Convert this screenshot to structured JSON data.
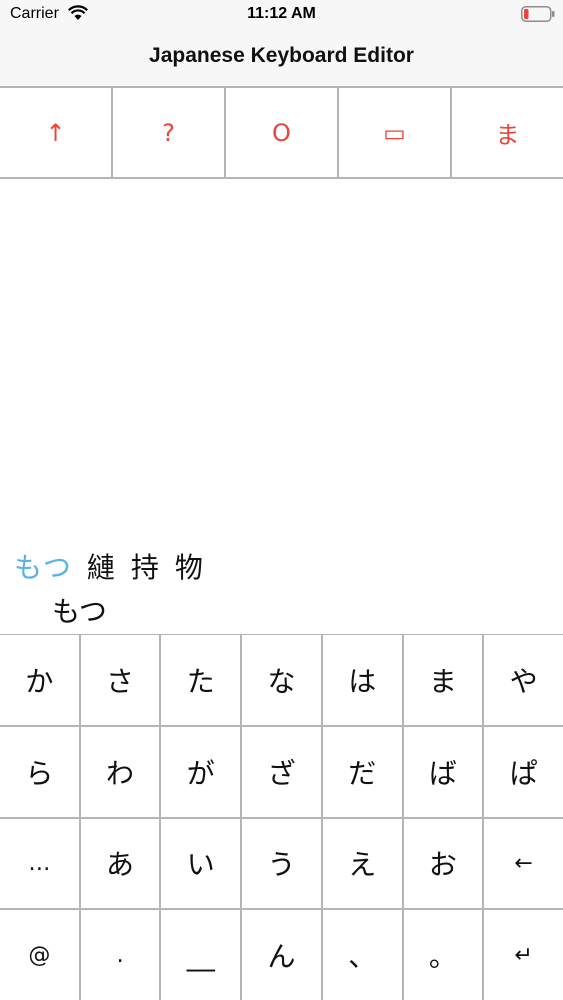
{
  "status_bar": {
    "carrier": "Carrier",
    "time": "11:12 AM"
  },
  "nav": {
    "title": "Japanese Keyboard Editor"
  },
  "toolbar": {
    "buttons": [
      "↑",
      "?",
      "O",
      "▭",
      "ま"
    ]
  },
  "candidates": {
    "items": [
      "もつ",
      "縺",
      "持",
      "物"
    ],
    "composing": "もつ"
  },
  "keyboard": {
    "rows": [
      [
        "か",
        "さ",
        "た",
        "な",
        "は",
        "ま",
        "や"
      ],
      [
        "ら",
        "わ",
        "が",
        "ざ",
        "だ",
        "ば",
        "ぱ"
      ],
      [
        "…",
        "あ",
        "い",
        "う",
        "え",
        "お",
        "←"
      ],
      [
        "@",
        ".",
        "__",
        "ん",
        "、",
        "。",
        "↵"
      ]
    ]
  },
  "colors": {
    "accent_red": "#e8453c",
    "selected_candidate": "#5ab2e4",
    "grid_line": "#b5b5b5"
  }
}
